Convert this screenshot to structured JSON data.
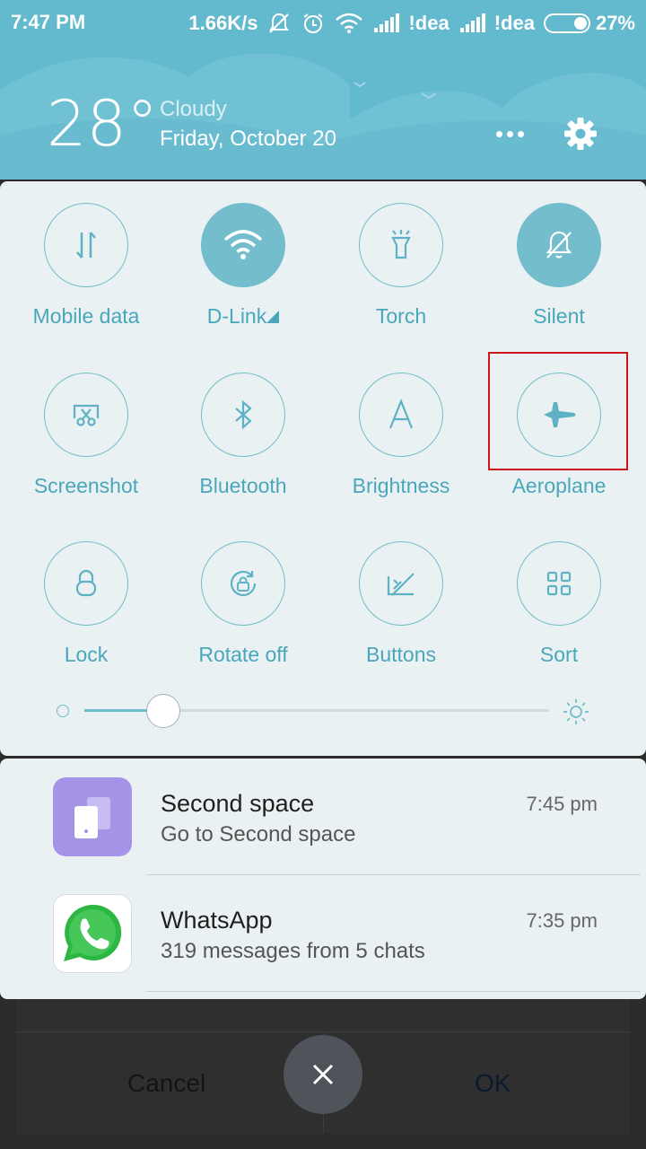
{
  "status_bar": {
    "time": "7:47 PM",
    "net_speed": "1.66K/s",
    "carrier1": "!dea",
    "carrier2": "!dea",
    "battery": "27%",
    "icons": [
      "silent-icon",
      "alarm-icon",
      "wifi-icon",
      "signal-icon",
      "signal-icon",
      "battery-icon"
    ]
  },
  "weather": {
    "temperature": "28°",
    "condition": "Cloudy",
    "date": "Friday, October 20"
  },
  "quick_settings": {
    "tiles": [
      {
        "label": "Mobile data",
        "icon": "mobile-data-icon",
        "active": false
      },
      {
        "label": "D-Link",
        "icon": "wifi-icon",
        "active": true
      },
      {
        "label": "Torch",
        "icon": "torch-icon",
        "active": false
      },
      {
        "label": "Silent",
        "icon": "silent-icon",
        "active": true
      },
      {
        "label": "Screenshot",
        "icon": "screenshot-icon",
        "active": false
      },
      {
        "label": "Bluetooth",
        "icon": "bluetooth-icon",
        "active": false
      },
      {
        "label": "Brightness",
        "icon": "brightness-auto-icon",
        "active": false
      },
      {
        "label": "Aeroplane",
        "icon": "aeroplane-icon",
        "active": false
      },
      {
        "label": "Lock",
        "icon": "lock-icon",
        "active": false
      },
      {
        "label": "Rotate off",
        "icon": "rotate-lock-icon",
        "active": false
      },
      {
        "label": "Buttons",
        "icon": "buttons-icon",
        "active": false
      },
      {
        "label": "Sort",
        "icon": "sort-grid-icon",
        "active": false
      }
    ],
    "brightness_level": 0.17
  },
  "notifications": [
    {
      "app": "Second space",
      "text": "Go to Second space",
      "time": "7:45 pm",
      "icon": "second-space-icon"
    },
    {
      "app": "WhatsApp",
      "text": "319 messages from 5 chats",
      "time": "7:35 pm",
      "icon": "whatsapp-icon"
    }
  ],
  "dialog": {
    "cancel_label": "Cancel",
    "ok_label": "OK"
  },
  "colors": {
    "header": "#63b9cd",
    "accent": "#4aa7bb",
    "panel": "#eaf1f3",
    "highlight": "#d0141b"
  }
}
